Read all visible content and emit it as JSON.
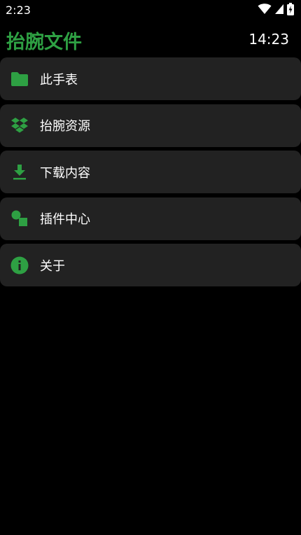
{
  "status_bar": {
    "time": "2:23",
    "icons": [
      "wifi-icon",
      "cellular-signal-icon",
      "battery-charging-icon"
    ]
  },
  "header": {
    "title": "抬腕文件",
    "clock": "14:23"
  },
  "theme": {
    "accent": "#2ea043",
    "card_bg": "#222222",
    "background": "#000000"
  },
  "menu": {
    "items": [
      {
        "label": "此手表",
        "icon": "folder-icon"
      },
      {
        "label": "抬腕资源",
        "icon": "dropbox-icon"
      },
      {
        "label": "下载内容",
        "icon": "download-icon"
      },
      {
        "label": "插件中心",
        "icon": "plugin-shapes-icon"
      },
      {
        "label": "关于",
        "icon": "info-icon"
      }
    ]
  }
}
